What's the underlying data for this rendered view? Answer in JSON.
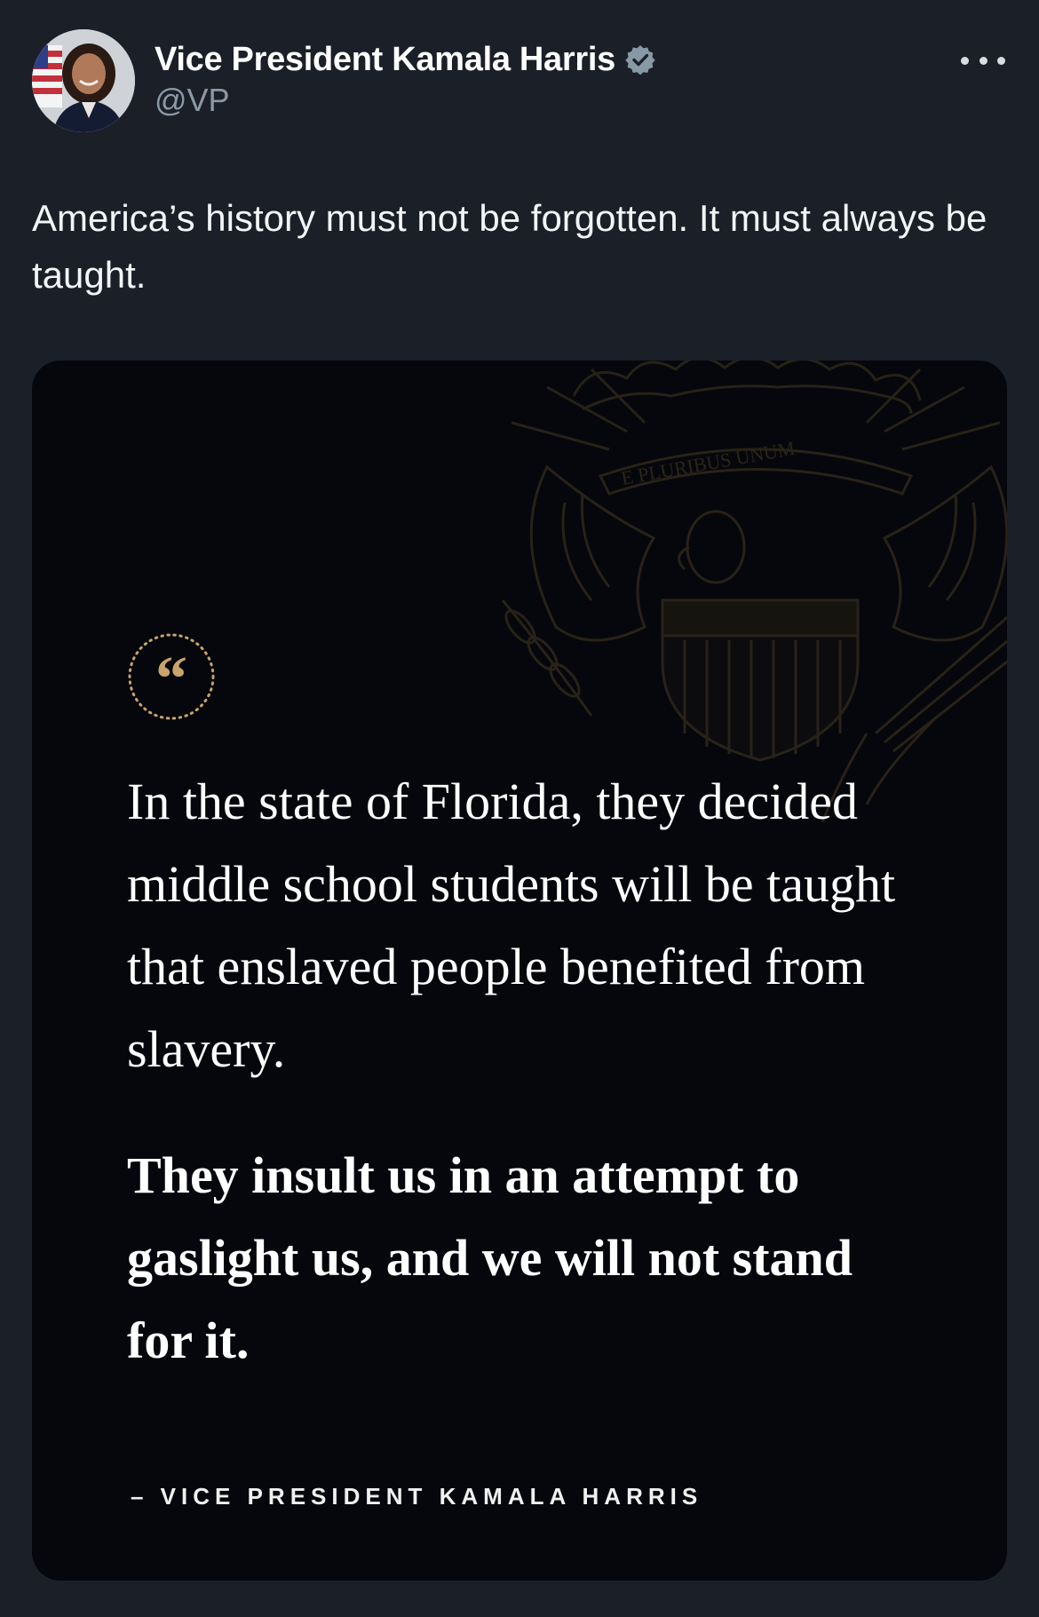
{
  "author": {
    "display_name": "Vice President Kamala Harris",
    "handle": "@VP",
    "verified_icon": "verified-badge-icon",
    "avatar_icon": "avatar"
  },
  "tweet": {
    "text": "America’s history must not be forgotten. It must always be taught."
  },
  "media": {
    "seal_motto": "E PLURIBUS UNUM",
    "quote_icon": "quote-mark-icon",
    "quote_mark": "“",
    "quote_part_1": "In the state of Florida, they decided middle school students will be taught that enslaved people benefited from slavery.",
    "quote_part_2": "They insult us in an attempt to gaslight us, and we will not stand for it.",
    "attribution": "– VICE PRESIDENT KAMALA HARRIS"
  },
  "colors": {
    "background": "#1b1f28",
    "media_background": "#06070c",
    "accent_gold": "#c9a46a",
    "handle_gray": "#8b98a5",
    "verified": "#8899a6"
  }
}
